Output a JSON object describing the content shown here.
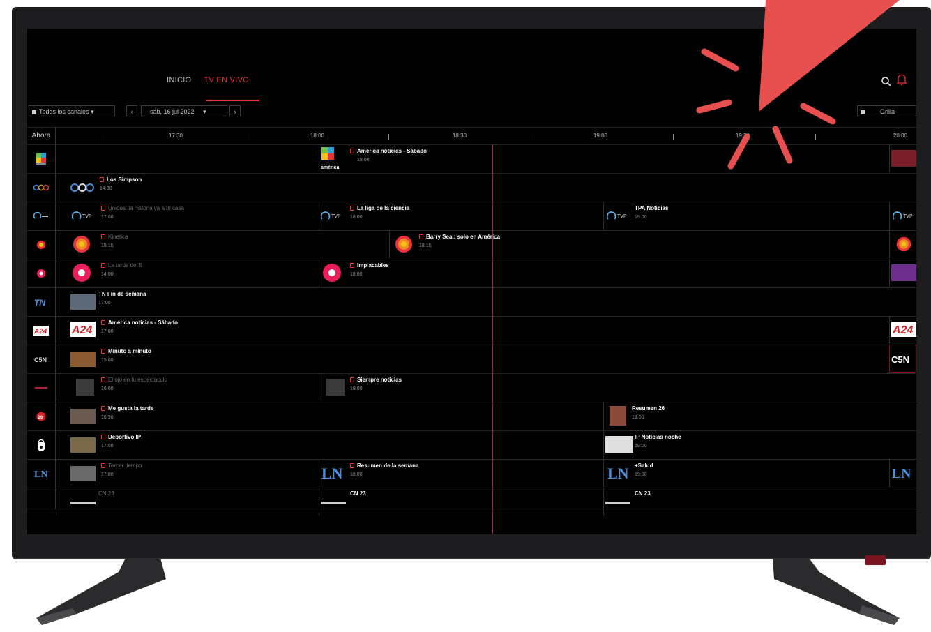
{
  "colors": {
    "accent": "#e8323c",
    "burst": "#e8504f",
    "screen": "#000000",
    "frame": "#1d1d1f"
  },
  "nav": {
    "tabs": [
      {
        "label": "INICIO",
        "active": false
      },
      {
        "label": "TV EN VIVO",
        "active": true
      }
    ],
    "search_icon": "search-icon",
    "notifications_icon": "bell-icon"
  },
  "filters": {
    "channels": "Todos los canales",
    "date": "sáb, 16 jul 2022",
    "view": "Grilla"
  },
  "timebar": {
    "now_label": "Ahora",
    "ticks": [
      "17:30",
      "18:00",
      "18:30",
      "19:00",
      "19:30",
      "20:00"
    ]
  },
  "channels": [
    {
      "name": "America",
      "programs": [
        {
          "title": "América noticias - Sábado",
          "time": "18:00",
          "rec": true,
          "past": false,
          "logo_text": "américa"
        }
      ]
    },
    {
      "name": "Tres",
      "programs": [
        {
          "title": "Los Simpson",
          "time": "14:30",
          "rec": true,
          "past": false
        }
      ]
    },
    {
      "name": "TVP",
      "programs": [
        {
          "title": "Unidos: la historia va a tu casa",
          "time": "17:00",
          "rec": true,
          "past": true
        },
        {
          "title": "La liga de la ciencia",
          "time": "18:00",
          "rec": true,
          "past": false
        },
        {
          "title": "TPA Noticias",
          "time": "19:00",
          "rec": false,
          "past": false
        }
      ]
    },
    {
      "name": "Telefe",
      "programs": [
        {
          "title": "Kinetica",
          "time": "15:15",
          "rec": true,
          "past": true
        },
        {
          "title": "Barry Seal: solo en América",
          "time": "18:15",
          "rec": true,
          "past": false
        }
      ]
    },
    {
      "name": "Trece",
      "programs": [
        {
          "title": "La tarde del 5",
          "time": "14:00",
          "rec": true,
          "past": true
        },
        {
          "title": "Implacables",
          "time": "18:00",
          "rec": true,
          "past": false
        }
      ]
    },
    {
      "name": "TN",
      "programs": [
        {
          "title": "TN Fin de semana",
          "time": "17:00",
          "rec": false,
          "past": false
        }
      ]
    },
    {
      "name": "A24",
      "programs": [
        {
          "title": "América noticias - Sábado",
          "time": "17:00",
          "rec": true,
          "past": false
        }
      ]
    },
    {
      "name": "C5N",
      "programs": [
        {
          "title": "Minuto a minuto",
          "time": "15:00",
          "rec": true,
          "past": false
        }
      ]
    },
    {
      "name": "Canal 26",
      "programs": [
        {
          "title": "El ojo en tu espectáculo",
          "time": "16:00",
          "rec": true,
          "past": true
        },
        {
          "title": "Siempre noticias",
          "time": "18:00",
          "rec": true,
          "past": false
        }
      ]
    },
    {
      "name": "Canal 26b",
      "programs": [
        {
          "title": "Me gusta la tarde",
          "time": "16:30",
          "rec": true,
          "past": false
        },
        {
          "title": "Resumen 26",
          "time": "19:00",
          "rec": false,
          "past": false
        }
      ]
    },
    {
      "name": "IP",
      "programs": [
        {
          "title": "Deportivo IP",
          "time": "17:00",
          "rec": true,
          "past": false
        },
        {
          "title": "IP Noticias noche",
          "time": "19:00",
          "rec": false,
          "past": false
        }
      ]
    },
    {
      "name": "LN",
      "programs": [
        {
          "title": "Tercer tiempo",
          "time": "17:00",
          "rec": true,
          "past": true
        },
        {
          "title": "Resumen de la semana",
          "time": "18:00",
          "rec": true,
          "past": false
        },
        {
          "title": "+Salud",
          "time": "19:00",
          "rec": false,
          "past": false
        }
      ]
    },
    {
      "name": "CN23",
      "programs": [
        {
          "title": "CN 23",
          "time": "",
          "rec": false,
          "past": true
        },
        {
          "title": "CN 23",
          "time": "",
          "rec": false,
          "past": false
        },
        {
          "title": "CN 23",
          "time": "",
          "rec": false,
          "past": false
        }
      ]
    }
  ]
}
